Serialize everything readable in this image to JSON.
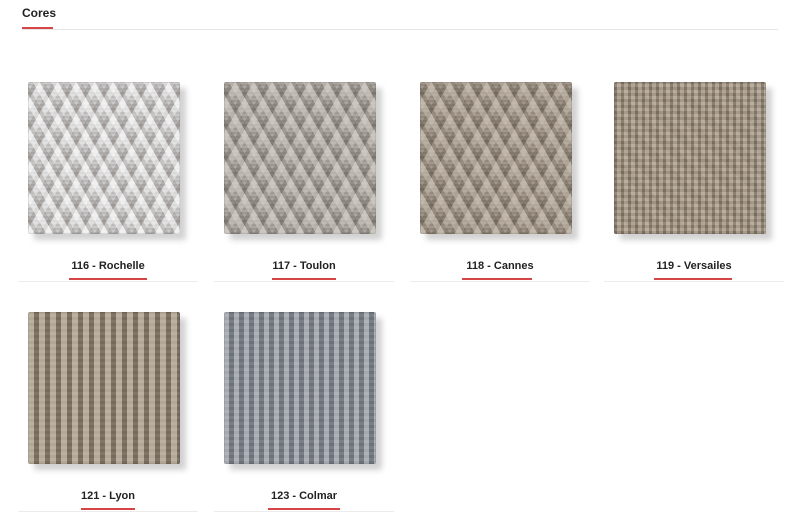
{
  "section": {
    "title": "Cores"
  },
  "swatches": [
    {
      "label": "116 - Rochelle"
    },
    {
      "label": "117 - Toulon"
    },
    {
      "label": "118 - Cannes"
    },
    {
      "label": "119 - Versailes"
    },
    {
      "label": "121 - Lyon"
    },
    {
      "label": "123 - Colmar"
    }
  ]
}
